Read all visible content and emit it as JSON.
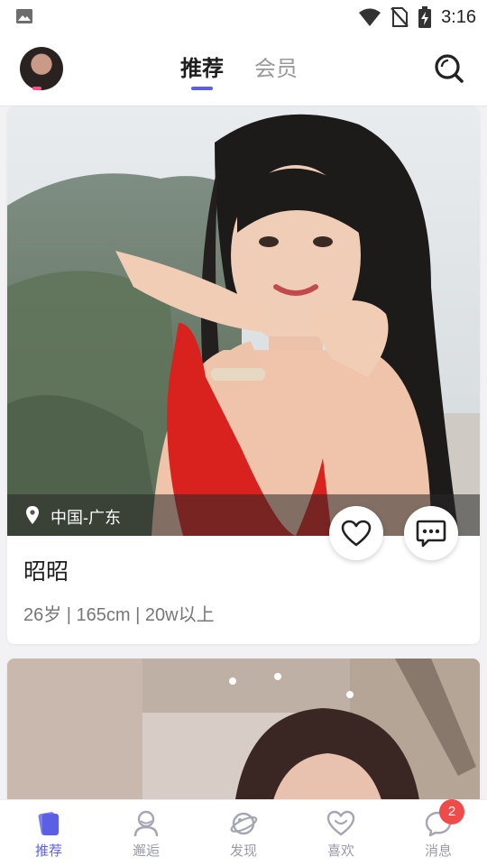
{
  "status_bar": {
    "time": "3:16",
    "icons": [
      "image-icon",
      "wifi-icon",
      "no-sim-icon",
      "battery-charging-icon"
    ]
  },
  "header": {
    "tabs": [
      {
        "label": "推荐",
        "active": true
      },
      {
        "label": "会员",
        "active": false
      }
    ],
    "search_icon": "search-icon"
  },
  "cards": [
    {
      "location": "中国-广东",
      "name": "昭昭",
      "details": "26岁 | 165cm | 20w以上",
      "actions": [
        "heart-icon",
        "chat-icon"
      ]
    },
    {
      "location": "",
      "name": "",
      "details": ""
    }
  ],
  "bottom_nav": {
    "items": [
      {
        "label": "推荐",
        "icon": "cards-icon",
        "active": true
      },
      {
        "label": "邂逅",
        "icon": "person-icon",
        "active": false
      },
      {
        "label": "发现",
        "icon": "planet-icon",
        "active": false
      },
      {
        "label": "喜欢",
        "icon": "heart-smile-icon",
        "active": false
      },
      {
        "label": "消息",
        "icon": "message-icon",
        "active": false
      }
    ],
    "message_badge": "2"
  },
  "colors": {
    "accent": "#5b5fe6",
    "badge": "#ef4b4b",
    "background": "#f2f2f4"
  }
}
